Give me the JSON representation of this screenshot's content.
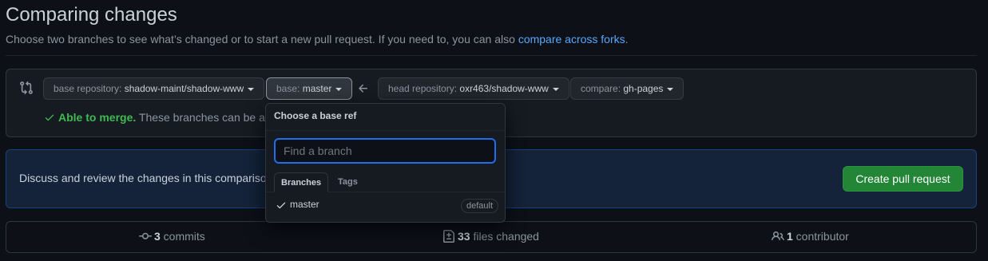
{
  "page": {
    "title": "Comparing changes",
    "subtitle": "Choose two branches to see what’s changed or to start a new pull request. If you need to, you can also ",
    "subtitle_link": "compare across forks",
    "subtitle_end": "."
  },
  "range": {
    "base_repo_key": "base repository: ",
    "base_repo_value": "shadow-maint/shadow-www",
    "base_key": "base: ",
    "base_value": "master",
    "head_repo_key": "head repository: ",
    "head_repo_value": "oxr463/shadow-www",
    "compare_key": "compare: ",
    "compare_value": "gh-pages",
    "merge_status": "Able to merge.",
    "merge_detail": " These branches can be a"
  },
  "discuss": {
    "text": "Discuss and review the changes in this compariso",
    "create_button": "Create pull request"
  },
  "stats": {
    "commits_count": "3",
    "commits_label": " commits",
    "files_count": "33",
    "files_label": " files changed",
    "contributors_count": "1",
    "contributors_label": " contributor"
  },
  "dropdown": {
    "title": "Choose a base ref",
    "placeholder": "Find a branch",
    "tabs": [
      "Branches",
      "Tags"
    ],
    "items": [
      {
        "label": "master",
        "badge": "default",
        "selected": true
      }
    ]
  },
  "colors": {
    "background": "#0d1117",
    "link": "#58a6ff",
    "success": "#3fb950",
    "primary_button": "#238636",
    "focus": "#1f6feb"
  }
}
